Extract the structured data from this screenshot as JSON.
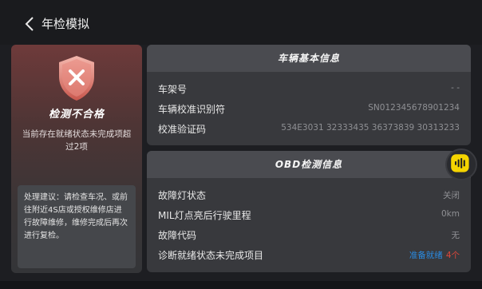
{
  "header": {
    "title": "年检模拟"
  },
  "result": {
    "status": "检测不合格",
    "description": "当前存在就绪状态未完成项超过2项",
    "advice": "处理建议：请检查车况、或前往附近4S店或授权维修店进行故障维修，维修完成后再次进行复检。"
  },
  "vehicle_info": {
    "title": "车辆基本信息",
    "rows": [
      {
        "label": "车架号",
        "value": "- -"
      },
      {
        "label": "车辆校准识别符",
        "value": "SN012345678901234"
      },
      {
        "label": "校准验证码",
        "value": "534E3031 32333435 36373839 30313233"
      }
    ]
  },
  "obd_info": {
    "title": "OBD检测信息",
    "rows": [
      {
        "label": "故障灯状态",
        "value": "关闭"
      },
      {
        "label": "MIL灯点亮后行驶里程",
        "value": "0km"
      },
      {
        "label": "故障代码",
        "value": "无"
      },
      {
        "label": "诊断就绪状态未完成项目",
        "value": "准备就绪",
        "count": "4个"
      }
    ]
  },
  "colors": {
    "accent_yellow": "#f5d400",
    "fail_red": "#e0473a",
    "link_blue": "#2a8ae0"
  },
  "icons": {
    "back": "chevron-left-icon",
    "shield": "shield-x-icon",
    "floating": "voice-wave-icon"
  }
}
